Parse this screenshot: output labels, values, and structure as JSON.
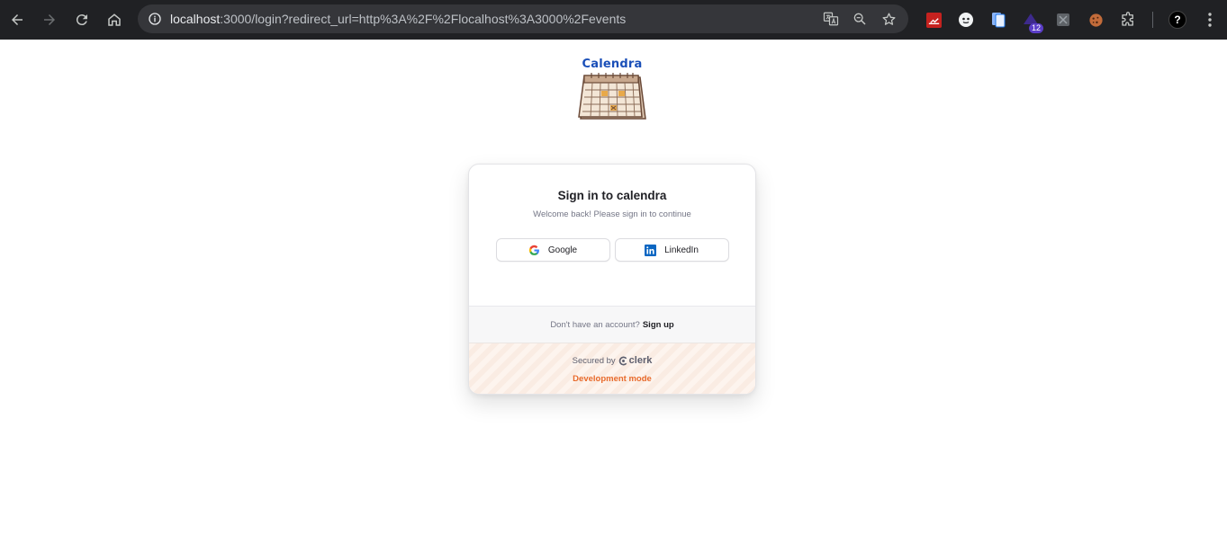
{
  "browser": {
    "url_host": "localhost",
    "url_rest": ":3000/login?redirect_url=http%3A%2F%2Flocalhost%3A3000%2Fevents",
    "extension_badge": "12",
    "profile_initial": "?"
  },
  "logo": {
    "text": "Calendra"
  },
  "signin": {
    "title": "Sign in to calendra",
    "subtitle": "Welcome back! Please sign in to continue",
    "google_label": "Google",
    "linkedin_label": "LinkedIn"
  },
  "footer": {
    "prompt": "Don't have an account?",
    "signup_label": "Sign up"
  },
  "dev": {
    "secured_by": "Secured by",
    "brand": "clerk",
    "mode": "Development mode"
  },
  "colors": {
    "accent_dev": "#e86a2b",
    "logo_blue": "#1a4fb8",
    "linkedin": "#0a66c2"
  }
}
